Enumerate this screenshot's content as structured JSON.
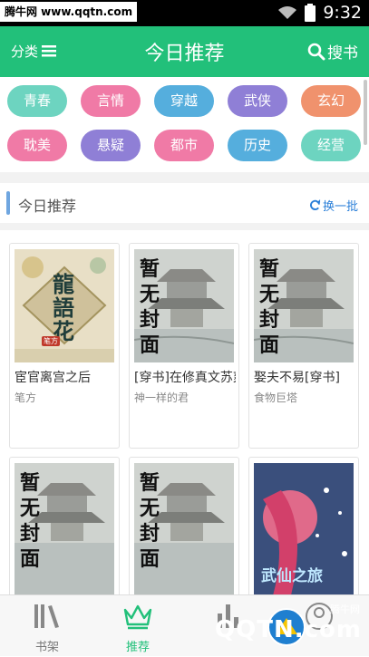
{
  "status_bar": {
    "watermark": "腾牛网 www.qqtn.com",
    "time": "9:32"
  },
  "header": {
    "category_label": "分类",
    "title": "今日推荐",
    "search_label": "搜书"
  },
  "tags": [
    {
      "label": "青春",
      "color": "#6dd4c0"
    },
    {
      "label": "言情",
      "color": "#f07aa6"
    },
    {
      "label": "穿越",
      "color": "#55aedd"
    },
    {
      "label": "武侠",
      "color": "#8f7fd6"
    },
    {
      "label": "玄幻",
      "color": "#f0926d"
    },
    {
      "label": "耽美",
      "color": "#f07aa6"
    },
    {
      "label": "悬疑",
      "color": "#8f7fd6"
    },
    {
      "label": "都市",
      "color": "#f07aa6"
    },
    {
      "label": "历史",
      "color": "#55aedd"
    },
    {
      "label": "经营",
      "color": "#6dd4c0"
    }
  ],
  "section": {
    "title": "今日推荐",
    "refresh_label": "换一批"
  },
  "books": [
    {
      "title": "宦官离宫之后",
      "author": "笔方",
      "cover_text": [
        "龍",
        "語",
        "花"
      ],
      "cover_seal": "笔方"
    },
    {
      "title": "[穿书]在修真文苏爽一生",
      "author": "神一样的君",
      "cover_text": [
        "暂",
        "无",
        "封",
        "面"
      ]
    },
    {
      "title": "娶夫不易[穿书]",
      "author": "食物巨塔",
      "cover_text": [
        "暂",
        "无",
        "封",
        "面"
      ]
    },
    {
      "title": "",
      "author": "",
      "cover_text": [
        "暂",
        "无",
        "封",
        "面"
      ]
    },
    {
      "title": "",
      "author": "",
      "cover_text": [
        "暂",
        "无",
        "封",
        "面"
      ]
    },
    {
      "title": "",
      "author": "",
      "cover_text": [
        "武仙之旅"
      ]
    }
  ],
  "bottom_nav": [
    {
      "label": "书架",
      "icon": "bookshelf-icon"
    },
    {
      "label": "推荐",
      "icon": "crown-icon",
      "active": true
    },
    {
      "label": "",
      "icon": "ranking-icon"
    },
    {
      "label": "",
      "icon": "user-icon"
    }
  ],
  "watermark_bottom": {
    "text": "QQTN.com",
    "small": "腾牛网"
  },
  "colors": {
    "accent": "#22c07a",
    "link": "#2a7fd8"
  }
}
